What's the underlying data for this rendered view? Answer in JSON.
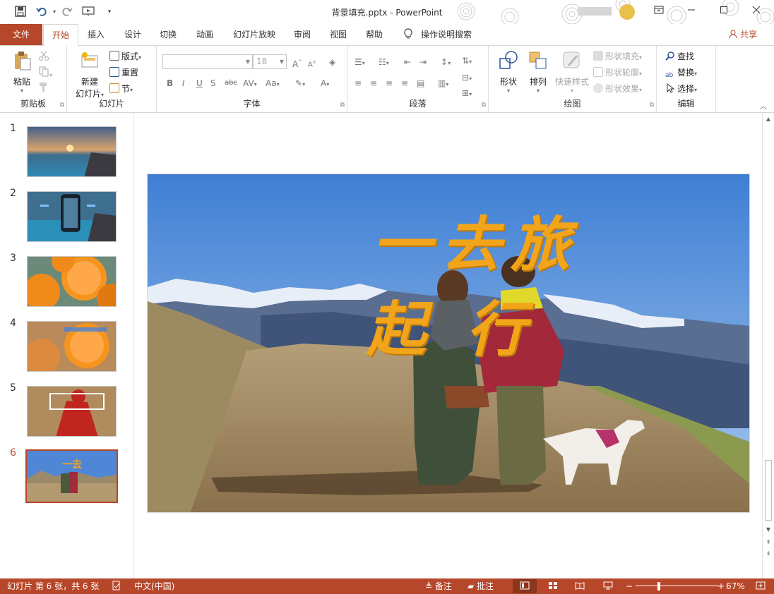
{
  "window": {
    "title": "背景填充.pptx  -  PowerPoint"
  },
  "qat": [
    "save-icon",
    "undo-icon",
    "redo-icon",
    "present-from-start-icon",
    "customize-icon"
  ],
  "tabs": {
    "file": "文件",
    "items": [
      "开始",
      "插入",
      "设计",
      "切换",
      "动画",
      "幻灯片放映",
      "审阅",
      "视图",
      "帮助"
    ],
    "tell_me": "操作说明搜索",
    "share": "共享"
  },
  "ribbon": {
    "clipboard": {
      "label": "剪贴板",
      "paste": "粘贴"
    },
    "slides": {
      "label": "幻灯片",
      "new_slide_1": "新建",
      "new_slide_2": "幻灯片",
      "layout": "版式",
      "reset": "重置",
      "section": "节"
    },
    "font": {
      "label": "字体",
      "font_name": "",
      "font_size": "18"
    },
    "paragraph": {
      "label": "段落"
    },
    "drawing": {
      "label": "绘图",
      "shapes": "形状",
      "arrange": "排列",
      "quick_styles": "快速样式",
      "fill": "形状填充",
      "outline": "形状轮廓",
      "effects": "形状效果"
    },
    "editing": {
      "label": "编辑",
      "find": "查找",
      "replace": "替换",
      "select": "选择"
    }
  },
  "slides": {
    "numbers": [
      "1",
      "2",
      "3",
      "4",
      "5",
      "6"
    ],
    "selected_index": 6,
    "current": {
      "title_top": "一去旅",
      "title_bottom": "起 行"
    }
  },
  "status": {
    "slide_info": "幻灯片 第 6 张，共 6 张",
    "language": "中文(中国)",
    "notes": "备注",
    "comments": "批注",
    "zoom": "67%"
  },
  "colors": {
    "accent": "#b7472a",
    "title_text": "#f2a51a",
    "sky": "#4f86d6"
  }
}
